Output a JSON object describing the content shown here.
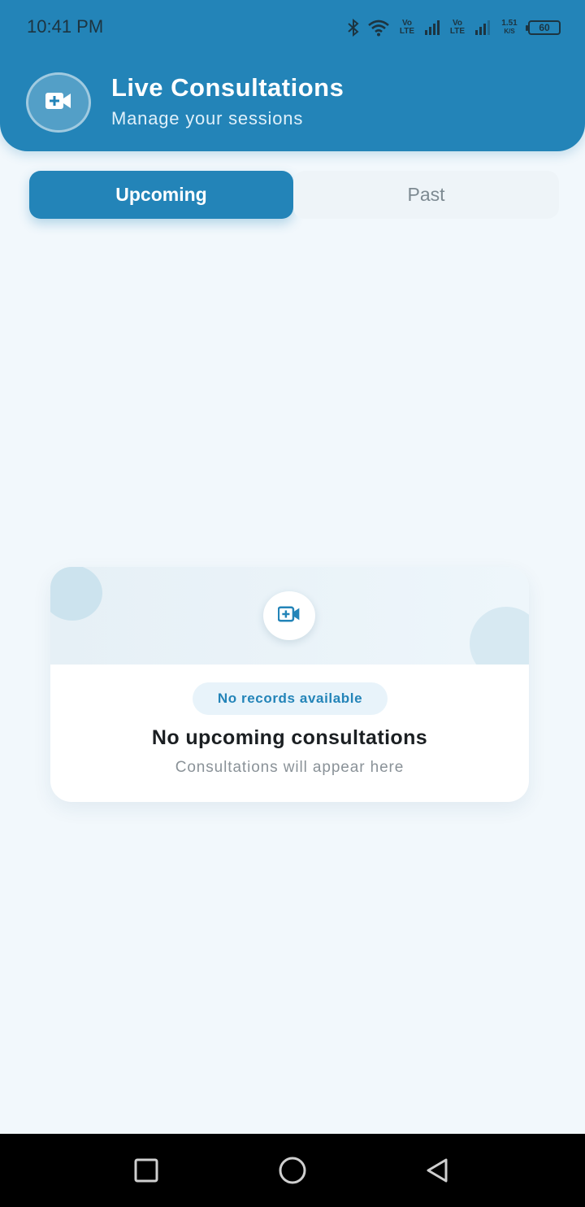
{
  "status_bar": {
    "time": "10:41 PM",
    "volte_1": "Vo\nLTE",
    "volte_2": "Vo\nLTE",
    "net_speed_value": "1.51",
    "net_speed_unit": "K/S",
    "battery": "60"
  },
  "header": {
    "title": "Live Consultations",
    "subtitle": "Manage your sessions",
    "icon": "video-plus-icon"
  },
  "tabs": [
    {
      "label": "Upcoming",
      "active": true
    },
    {
      "label": "Past",
      "active": false
    }
  ],
  "empty_state": {
    "icon": "video-plus-icon",
    "badge": "No records available",
    "title": "No upcoming consultations",
    "subtitle": "Consultations will appear here"
  },
  "navbar": {
    "buttons": [
      "recents-icon",
      "home-icon",
      "back-icon"
    ]
  },
  "colors": {
    "primary": "#2384b8",
    "background": "#f2f8fc",
    "text_dark": "#1b1f22",
    "text_muted": "#8a9298"
  }
}
